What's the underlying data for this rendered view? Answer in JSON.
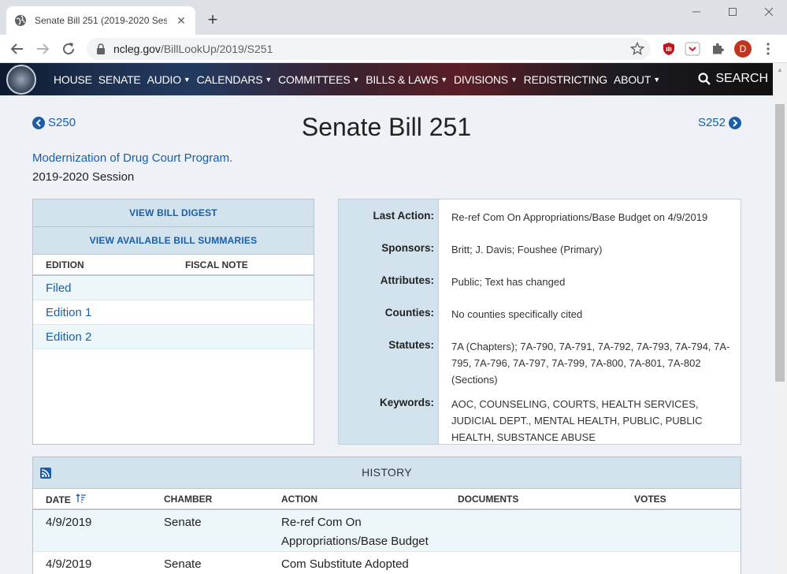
{
  "browser": {
    "tab_title": "Senate Bill 251 (2019-2020 Session)",
    "url_host": "ncleg.gov",
    "url_path": "/BillLookUp/2019/S251",
    "profile_initial": "D"
  },
  "nav": {
    "items": [
      "HOUSE",
      "SENATE",
      "AUDIO",
      "CALENDARS",
      "COMMITTEES",
      "BILLS & LAWS",
      "DIVISIONS",
      "REDISTRICTING",
      "ABOUT"
    ],
    "dropdown_items": [
      false,
      false,
      true,
      true,
      true,
      true,
      true,
      false,
      true
    ],
    "search_label": "SEARCH"
  },
  "bill": {
    "prev_label": "S250",
    "next_label": "S252",
    "title": "Senate Bill 251",
    "subtitle": "Modernization of Drug Court Program.",
    "session": "2019-2020 Session"
  },
  "documents": {
    "digest_button": "VIEW BILL DIGEST",
    "summaries_button": "VIEW AVAILABLE BILL SUMMARIES",
    "col_edition": "EDITION",
    "col_fiscal": "FISCAL NOTE",
    "editions": [
      "Filed",
      "Edition 1",
      "Edition 2"
    ]
  },
  "details": {
    "last_action_label": "Last Action:",
    "last_action": "Re-ref Com On Appropriations/Base Budget on 4/9/2019",
    "sponsors_label": "Sponsors:",
    "sponsors": "Britt; J. Davis; Foushee (Primary)",
    "attributes_label": "Attributes:",
    "attributes": "Public; Text has changed",
    "counties_label": "Counties:",
    "counties": "No counties specifically cited",
    "statutes_label": "Statutes:",
    "statutes": "7A (Chapters); 7A-790, 7A-791, 7A-792, 7A-793, 7A-794, 7A-795, 7A-796, 7A-797, 7A-799, 7A-800, 7A-801, 7A-802 (Sections)",
    "keywords_label": "Keywords:",
    "keywords": "AOC, COUNSELING, COURTS, HEALTH SERVICES, JUDICIAL DEPT., MENTAL HEALTH, PUBLIC, PUBLIC HEALTH, SUBSTANCE ABUSE"
  },
  "history": {
    "title": "HISTORY",
    "col_date": "DATE",
    "col_chamber": "CHAMBER",
    "col_action": "ACTION",
    "col_documents": "DOCUMENTS",
    "col_votes": "VOTES",
    "rows": [
      {
        "date": "4/9/2019",
        "chamber": "Senate",
        "action_line1": "Re-ref Com On",
        "action_line2": "Appropriations/Base Budget"
      },
      {
        "date": "4/9/2019",
        "chamber": "Senate",
        "action_line1": "Com Substitute Adopted",
        "action_line2": ""
      }
    ]
  },
  "colors": {
    "link": "#1a5ea8",
    "panel_header": "#d3e3ee",
    "page_bg": "#eef2f7"
  }
}
